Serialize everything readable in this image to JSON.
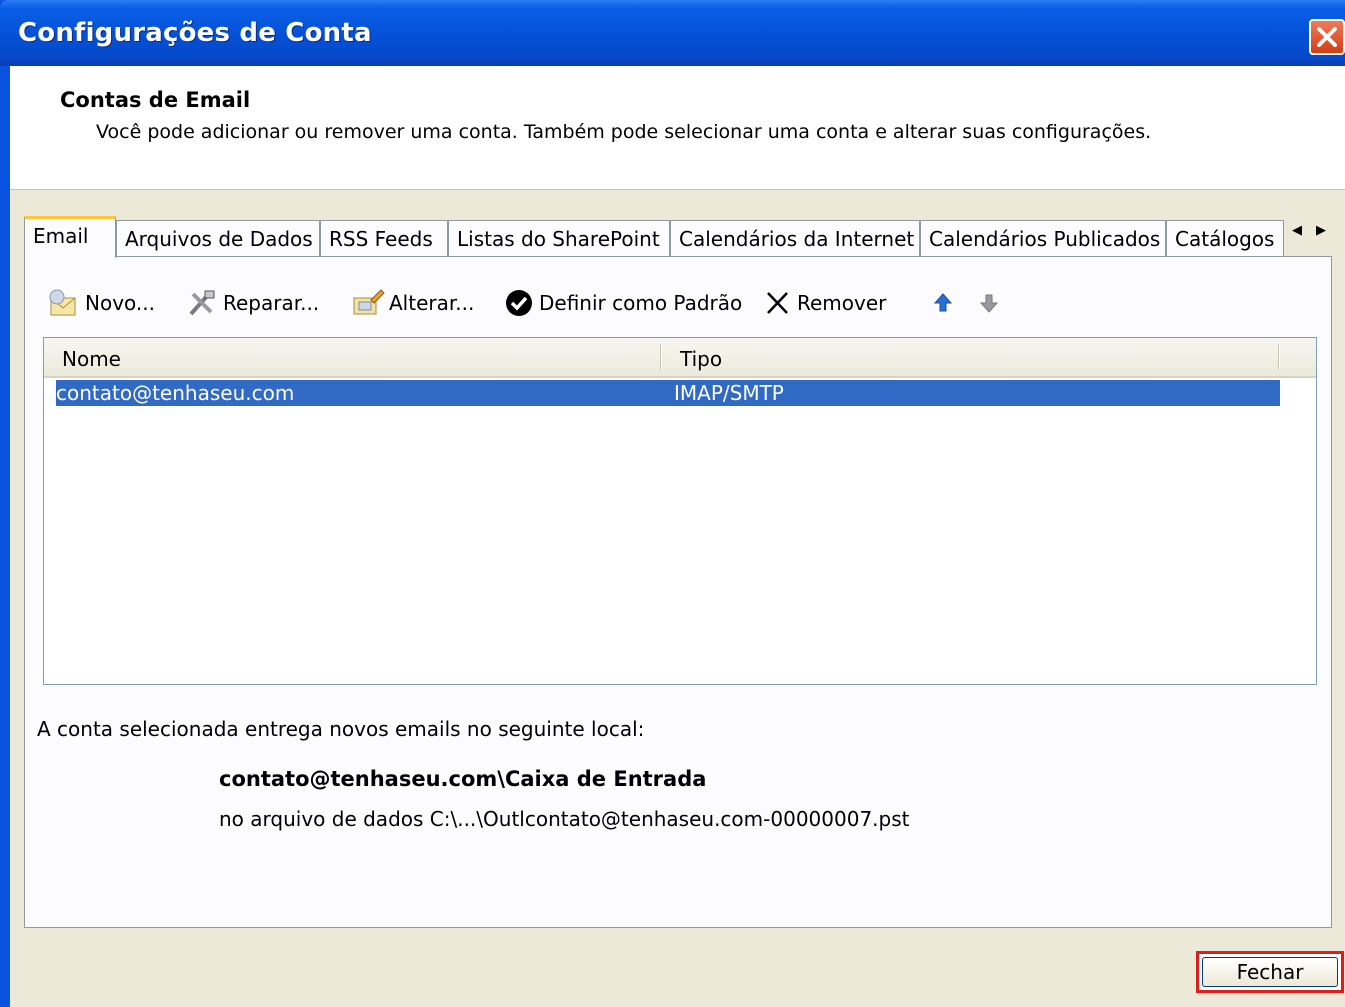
{
  "window": {
    "title": "Configurações de Conta"
  },
  "header": {
    "title": "Contas de Email",
    "description": "Você pode adicionar ou remover uma conta. Também pode selecionar uma conta e alterar suas configurações."
  },
  "tabs": [
    {
      "label": "Email",
      "active": true
    },
    {
      "label": "Arquivos de Dados"
    },
    {
      "label": "RSS Feeds"
    },
    {
      "label": "Listas do SharePoint"
    },
    {
      "label": "Calendários da Internet"
    },
    {
      "label": "Calendários Publicados"
    },
    {
      "label": "Catálogos"
    }
  ],
  "toolbar": {
    "new_label": "Novo...",
    "repair_label": "Reparar...",
    "change_label": "Alterar...",
    "default_label": "Definir como Padrão",
    "remove_label": "Remover"
  },
  "list": {
    "columns": [
      "Nome",
      "Tipo"
    ],
    "rows": [
      {
        "name": "contato@tenhaseu.com",
        "type": "IMAP/SMTP",
        "selected": true
      }
    ]
  },
  "delivery": {
    "label": "A conta selecionada entrega novos emails no seguinte local:",
    "path": "contato@tenhaseu.com\\Caixa de Entrada",
    "file": "no arquivo de dados C:\\...\\Outlcontato@tenhaseu.com-00000007.pst"
  },
  "footer": {
    "close_label": "Fechar"
  },
  "colors": {
    "titlebar": "#0552d8",
    "selection": "#316ac5",
    "highlight_border": "#e21b1b",
    "dialog_bg": "#ece9d8"
  }
}
